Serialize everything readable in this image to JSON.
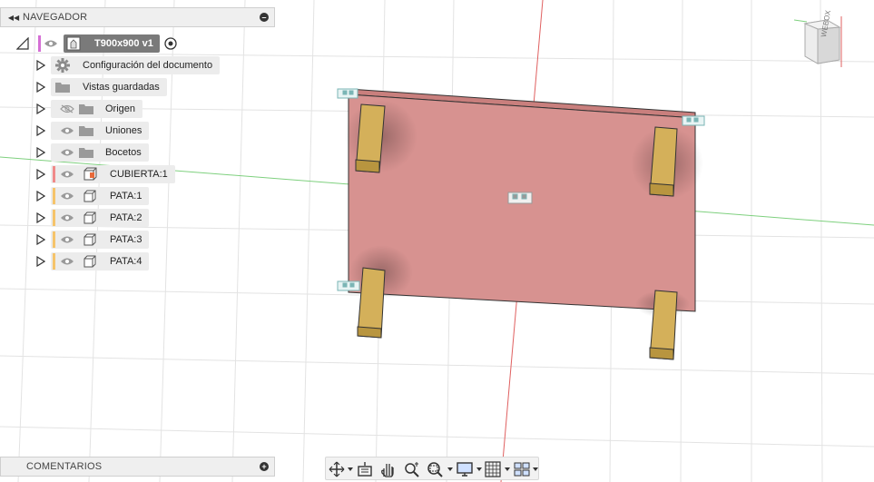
{
  "navigator": {
    "title": "NAVEGADOR",
    "document": {
      "name": "T900x900 v1"
    },
    "items": [
      {
        "label": "Configuración del documento",
        "kind": "settings"
      },
      {
        "label": "Vistas guardadas",
        "kind": "folder"
      },
      {
        "label": "Origen",
        "kind": "folder",
        "eye": "hidden"
      },
      {
        "label": "Uniones",
        "kind": "folder",
        "eye": "visible"
      },
      {
        "label": "Bocetos",
        "kind": "folder",
        "eye": "visible"
      },
      {
        "label": "CUBIERTA:1",
        "kind": "component",
        "color": "#f08a8a"
      },
      {
        "label": "PATA:1",
        "kind": "body",
        "color": "#f5c46b"
      },
      {
        "label": "PATA:2",
        "kind": "body",
        "color": "#f5c46b"
      },
      {
        "label": "PATA:3",
        "kind": "body",
        "color": "#f5c46b"
      },
      {
        "label": "PATA:4",
        "kind": "body",
        "color": "#f5c46b"
      }
    ]
  },
  "comments": {
    "title": "COMENTARIOS"
  },
  "viewcube": {
    "label": "WEBOX"
  },
  "colors": {
    "tabletop": "#d79290",
    "leg": "#d4b05a",
    "axis_red": "#e06060",
    "axis_green": "#7ed07e",
    "grid": "#e3e3e3"
  },
  "toolbar": {
    "buttons": [
      "orbit-icon",
      "look-at-icon",
      "pan-icon",
      "zoom-icon",
      "fit-icon",
      "display-icon",
      "grid-icon",
      "viewports-icon"
    ]
  }
}
